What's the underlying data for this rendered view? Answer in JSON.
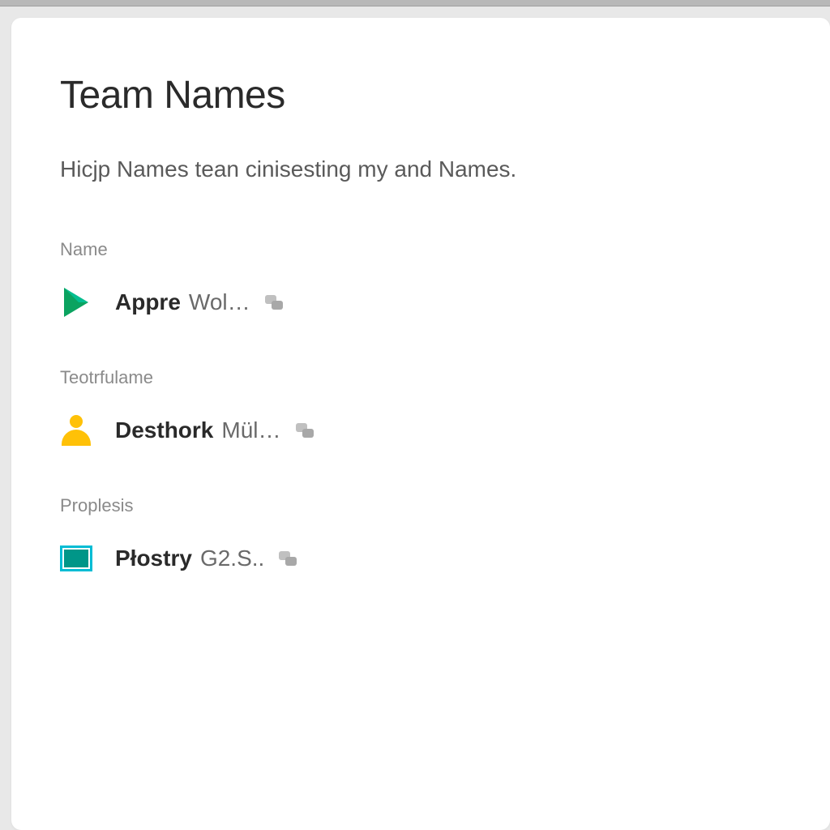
{
  "page": {
    "title": "Team Names",
    "subtitle": "Hicjp Names tean cinisesting my and Names."
  },
  "sections": [
    {
      "label": "Name",
      "icon": "play-icon",
      "bold": "Appre",
      "light": "Wol…",
      "trailing": "chat-icon"
    },
    {
      "label": "Teotrfulame",
      "icon": "person-icon",
      "bold": "Desthork",
      "light": "Mül…",
      "trailing": "chat-icon"
    },
    {
      "label": "Proplesis",
      "icon": "square-icon",
      "bold": "Płostry",
      "light": "G2.S..",
      "trailing": "chat-icon"
    }
  ]
}
